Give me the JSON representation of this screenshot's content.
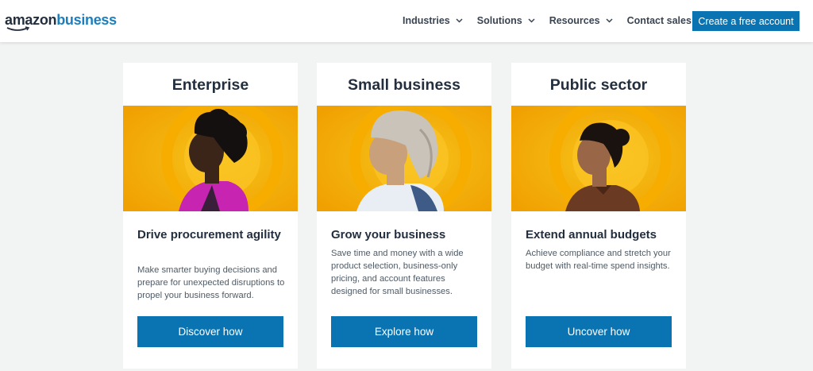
{
  "header": {
    "logo_amazon": "amazon",
    "logo_business": "business",
    "nav": [
      {
        "label": "Industries",
        "icon": "chevron-down-icon"
      },
      {
        "label": "Solutions",
        "icon": "chevron-down-icon"
      },
      {
        "label": "Resources",
        "icon": "chevron-down-icon"
      },
      {
        "label": "Contact sales"
      }
    ],
    "cta_label": "Create a free account"
  },
  "cards": [
    {
      "title": "Enterprise",
      "heading": "Drive procurement agility",
      "description": "Make smarter buying decisions and prepare for unexpected disruptions to propel your business forward.",
      "button": "Discover how",
      "accent": "#c724b1"
    },
    {
      "title": "Small business",
      "heading": "Grow your business",
      "description": "Save time and money with a wide product selection, business-only pricing, and account features designed for small businesses.",
      "button": "Explore how",
      "accent": "#e8eef4"
    },
    {
      "title": "Public sector",
      "heading": "Extend annual budgets",
      "description": "Achieve compliance and stretch your budget with real-time spend insights.",
      "button": "Uncover how",
      "accent": "#6b3a22"
    }
  ],
  "colors": {
    "brand_blue": "#0a73b1",
    "image_yellow": "#f5b800",
    "image_orange": "#f08c00"
  }
}
